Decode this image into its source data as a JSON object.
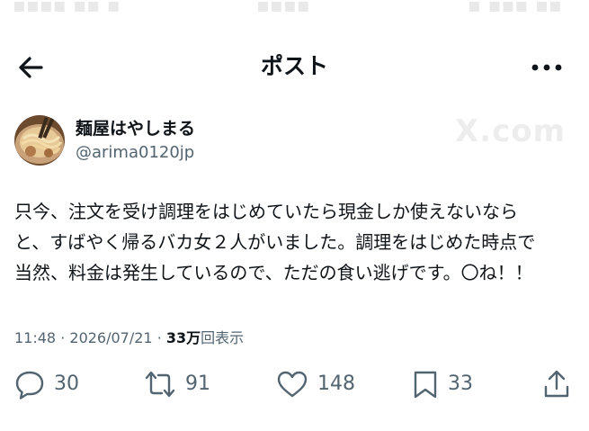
{
  "header": {
    "title": "ポスト"
  },
  "author": {
    "name": "麺屋はやしまる",
    "handle": "@arima0120jp"
  },
  "tweet": {
    "text": "只今、注文を受け調理をはじめていたら現金しか使えないなら\nと、すばやく帰るバカ女２人がいました。調理をはじめた時点で\n当然、料金は発生しているので、ただの食い逃げです。〇ね！！"
  },
  "meta": {
    "time": "11:48",
    "date": "2026/07/21",
    "views_count": "33万",
    "views_label": "回表示",
    "separator": "·"
  },
  "actions": {
    "reply_count": "30",
    "repost_count": "91",
    "like_count": "148",
    "bookmark_count": "33"
  },
  "watermark": "X.com",
  "icons": [
    "back-arrow-icon",
    "more-icon",
    "reply-icon",
    "repost-icon",
    "like-icon",
    "bookmark-icon",
    "share-icon"
  ]
}
